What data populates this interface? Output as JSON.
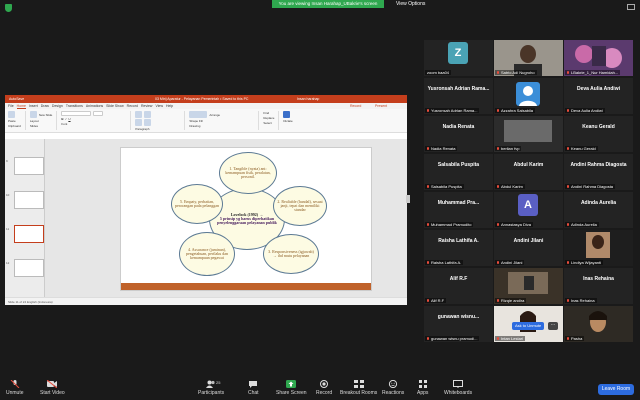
{
  "banner": {
    "text": "You are viewing Insan Harahap_UBakrie's screen",
    "view_options": "View Options"
  },
  "ppt": {
    "autosave": "AutoSave",
    "filename": "03 Mtrij Aparatur - Pelayanan Pemerintah • Saved to this PC",
    "user": "Insan harahap",
    "menu": [
      "File",
      "Home",
      "Insert",
      "Draw",
      "Design",
      "Transitions",
      "Animations",
      "Slide Show",
      "Record",
      "Review",
      "View",
      "Help"
    ],
    "record_label": "Record",
    "present_label": "Present",
    "ribbon": {
      "paste": "Paste",
      "new_slide": "New Slide",
      "reuse": "Reuse Slides",
      "layout": "Layout",
      "reset": "Reset",
      "section": "Section",
      "shapes": "Shapes",
      "arrange": "Arrange",
      "quick_styles": "Quick Styles",
      "shape_fill": "Shape Fill",
      "shape_outline": "Shape Outline",
      "shape_effects": "Shape Effects",
      "find": "Find",
      "replace": "Replace",
      "select": "Select",
      "dictate": "Dictate"
    },
    "groups": [
      "Clipboard",
      "Slides",
      "Font",
      "Paragraph",
      "Drawing",
      "Editing",
      "Voice"
    ],
    "thumb_numbers": [
      "9",
      "10",
      "11",
      "12"
    ],
    "status": "Slide 11 of 24   English (Indonesia)",
    "slide": {
      "center": {
        "title": "Lovelock (1992) →",
        "text": "5 prinsip yg harus diperhatikan penyelenggaraan pelayanan publik"
      },
      "c1": "1. Tangible (nyata) ant: kemampuan fisik, peralatan, personil.",
      "c2": "2. Realiable (handal), sesuai janji, tepat dan memiliki standar",
      "c3": "3. Responsiveness (tgjawab) → thd mutu pelayanan",
      "c4": "4. Assurance (jaminan), pengetahuan, perilaku dan kemampuan pegawai",
      "c5": "5. Empaty, perhatian, perorangan pada pelanggan"
    }
  },
  "gallery": [
    {
      "name": "zoom baa04",
      "type": "avatar",
      "letter": "Z",
      "color": "#4aa3b5",
      "muted": false
    },
    {
      "name": "Satrio Adi Nugroho",
      "type": "photo",
      "muted": true
    },
    {
      "name": "LBakrie_1_Nur Hamidah...",
      "type": "photo",
      "muted": true
    },
    {
      "name": "Yusronsah Adrian Rama...",
      "type": "name",
      "big": "Yusronsah Adrian Rama...",
      "muted": true
    },
    {
      "name": "Azzahra Salsabila",
      "type": "avatar-person",
      "muted": true
    },
    {
      "name": "Deva Aulia Andiwi",
      "type": "name",
      "big": "Deva Aulia Andiwi",
      "muted": true
    },
    {
      "name": "Nadia Renata",
      "type": "name",
      "big": "Nadia Renata",
      "muted": true
    },
    {
      "name": "berlian fvp",
      "type": "photo",
      "muted": true
    },
    {
      "name": "Keanu Gerald",
      "type": "name",
      "big": "Keanu Gerald",
      "muted": true
    },
    {
      "name": "Salsabila Puspita",
      "type": "name",
      "big": "Salsabila Puspita",
      "muted": true
    },
    {
      "name": "Abdul Karim",
      "type": "name",
      "big": "Abdul Karim",
      "muted": true
    },
    {
      "name": "Andini Rahma Diagosta",
      "type": "name",
      "big": "Andini Rahma Diagosta",
      "muted": true
    },
    {
      "name": "Muhammad Pramudito",
      "type": "name",
      "big": "Muhammad Pra...",
      "muted": true
    },
    {
      "name": "Annastasya Diva",
      "type": "avatar",
      "letter": "A",
      "color": "#5a5fc4",
      "muted": true
    },
    {
      "name": "Adinda Aurelia",
      "type": "name",
      "big": "Adinda Aurelia",
      "muted": true
    },
    {
      "name": "Raisha Lathifa A.",
      "type": "name",
      "big": "Raisha Lathifa A.",
      "muted": true
    },
    {
      "name": "Andini Jilani",
      "type": "name",
      "big": "Andini Jilani",
      "muted": true
    },
    {
      "name": "Lindiya Wijayanti",
      "type": "photo",
      "muted": true
    },
    {
      "name": "Alif R.F",
      "type": "name",
      "big": "Alif R.F",
      "muted": true
    },
    {
      "name": "Rizqie andira",
      "type": "photo",
      "muted": true
    },
    {
      "name": "Inas Rehaina",
      "type": "name",
      "big": "Inas Rehaina",
      "muted": true
    },
    {
      "name": "gunawan wisnu pramudi...",
      "type": "name",
      "big": "gunawan wisnu...",
      "muted": true
    },
    {
      "name": "Intan Lestari",
      "type": "photo",
      "muted": true
    },
    {
      "name": "Pasha",
      "type": "photo",
      "muted": true
    }
  ],
  "ask_unmute": "Ask to Unmute",
  "toolbar": {
    "unmute": "Unmute",
    "start_video": "Start Video",
    "participants": "Participants",
    "participants_count": "25",
    "chat": "Chat",
    "share_screen": "Share Screen",
    "record": "Record",
    "breakout": "Breakout Rooms",
    "reactions": "Reactions",
    "apps": "Apps",
    "whiteboards": "Whiteboards",
    "leave": "Leave Room"
  }
}
